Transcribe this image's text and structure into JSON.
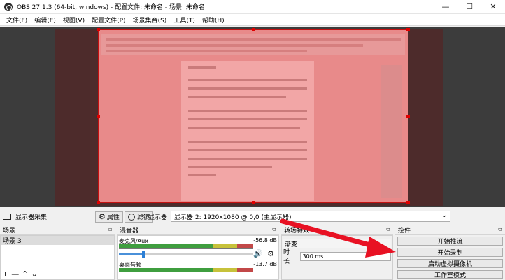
{
  "window": {
    "title": "OBS 27.1.3 (64-bit, windows) - 配置文件: 未命名 - 场景: 未命名",
    "minimize": "—",
    "maximize": "☐",
    "close": "✕"
  },
  "menu": [
    "文件(F)",
    "编辑(E)",
    "视图(V)",
    "配置文件(P)",
    "场景集合(S)",
    "工具(T)",
    "帮助(H)"
  ],
  "source_toolbar": {
    "source_name": "显示器采集",
    "properties_label": "属性",
    "filters_label": "滤镜",
    "display_label": "显示器",
    "display_value": "显示器 2: 1920x1080 @ 0,0 (主显示器)"
  },
  "scenes": {
    "title": "场景",
    "items": [
      "场景 3"
    ]
  },
  "mixer": {
    "title": "混音器",
    "tracks": [
      {
        "name": "麦克风/Aux",
        "db": "-56.8 dB",
        "volume": 0.18
      },
      {
        "name": "桌面音频",
        "db": "-13.7 dB",
        "volume": 0.6
      }
    ]
  },
  "transitions": {
    "title": "转场特效",
    "type": "渐变",
    "duration_label": "时长",
    "duration_value": "300 ms"
  },
  "controls": {
    "title": "控件",
    "buttons": [
      "开始推流",
      "开始录制",
      "启动虚拟摄像机",
      "工作室模式"
    ]
  },
  "colors": {
    "arrow": "#e81123",
    "meter_blue": "#2c7fd6"
  }
}
